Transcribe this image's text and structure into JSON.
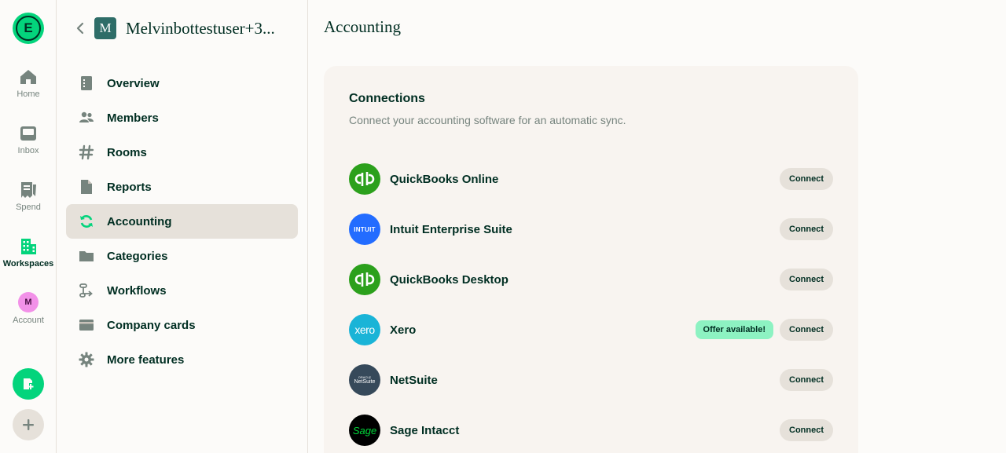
{
  "rail": {
    "logo_letter": "E",
    "items": [
      {
        "label": "Home",
        "icon": "home-icon"
      },
      {
        "label": "Inbox",
        "icon": "inbox-icon"
      },
      {
        "label": "Spend",
        "icon": "receipt-icon"
      },
      {
        "label": "Workspaces",
        "icon": "building-icon"
      },
      {
        "label": "Account",
        "icon": "avatar",
        "initial": "M"
      }
    ]
  },
  "workspace": {
    "avatar_letter": "M",
    "name": "Melvinbottestuser+3..."
  },
  "nav": [
    {
      "label": "Overview",
      "icon": "document-icon"
    },
    {
      "label": "Members",
      "icon": "users-icon"
    },
    {
      "label": "Rooms",
      "icon": "hashtag-icon"
    },
    {
      "label": "Reports",
      "icon": "page-icon"
    },
    {
      "label": "Accounting",
      "icon": "sync-icon",
      "active": true
    },
    {
      "label": "Categories",
      "icon": "folder-icon"
    },
    {
      "label": "Workflows",
      "icon": "workflow-icon"
    },
    {
      "label": "Company cards",
      "icon": "credit-card-icon"
    },
    {
      "label": "More features",
      "icon": "gear-icon"
    }
  ],
  "main": {
    "title": "Accounting",
    "connections": {
      "title": "Connections",
      "subtitle": "Connect your accounting software for an automatic sync.",
      "items": [
        {
          "name": "QuickBooks Online",
          "button": "Connect",
          "logo_text": "qb",
          "logo_bg": "#2ca01c"
        },
        {
          "name": "Intuit Enterprise Suite",
          "button": "Connect",
          "logo_text": "INTUIT",
          "logo_bg": "#236cff"
        },
        {
          "name": "QuickBooks Desktop",
          "button": "Connect",
          "logo_text": "qb",
          "logo_bg": "#2ca01c"
        },
        {
          "name": "Xero",
          "button": "Connect",
          "badge": "Offer available!",
          "logo_text": "xero",
          "logo_bg": "#1ab4d7"
        },
        {
          "name": "NetSuite",
          "button": "Connect",
          "logo_text": "NetSuite",
          "logo_subtext": "ORACLE",
          "logo_bg": "#36495a"
        },
        {
          "name": "Sage Intacct",
          "button": "Connect",
          "logo_text": "Sage",
          "logo_bg": "#000000"
        }
      ]
    }
  },
  "colors": {
    "accent_green": "#03d47c",
    "text_dark": "#002e22",
    "muted": "#76847e",
    "active_bg": "#e6e1da",
    "offer_badge": "#8df2c2"
  }
}
